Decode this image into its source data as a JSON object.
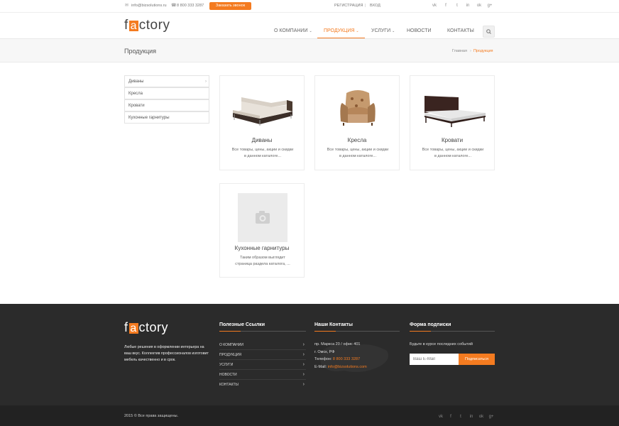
{
  "topbar": {
    "email": "info@bizsolutions.ru",
    "phone": "8 800 333 3287",
    "call_button": "Заказать звонок",
    "register": "РЕГИСТРАЦИЯ",
    "separator": "|",
    "login": "ВХОД",
    "social": [
      "vk",
      "f",
      "t",
      "in",
      "ok",
      "g+"
    ]
  },
  "header": {
    "logo_pre": "f",
    "logo_a": "a",
    "logo_post": "ctory",
    "nav": [
      "О КОМПАНИИ",
      "ПРОДУКЦИЯ",
      "УСЛУГИ",
      "НОВОСТИ",
      "КОНТАКТЫ"
    ],
    "nav_active": "ПРОДУКЦИЯ",
    "search_icon": "search-icon"
  },
  "pagebar": {
    "title": "Продукция",
    "breadcrumb": [
      "Главная",
      "Продукция"
    ]
  },
  "sidebar": {
    "items": [
      "Диваны",
      "Кресла",
      "Кровати",
      "Кухонные гарнитуры"
    ]
  },
  "products": [
    {
      "name": "Диваны",
      "desc": "Все товары, цены, акции и скидки в данном каталоге..."
    },
    {
      "name": "Кресла",
      "desc": "Все товары, цены, акции и скидки в данном каталоге..."
    },
    {
      "name": "Кровати",
      "desc": "Все товары, цены, акции и скидки в данном каталоге..."
    },
    {
      "name": "Кухонные гарнитуры",
      "desc": "Таким образом выглядит страница раздела каталога, ..."
    }
  ],
  "footer": {
    "about": "Любые решения в оформлении интерьера на ваш вкус. Коллектив профессионалов изготовит мебель качественно и в срок.",
    "links_title": "Полезные Ссылки",
    "links": [
      "О КОМПАНИИ",
      "ПРОДУКЦИЯ",
      "УСЛУГИ",
      "НОВОСТИ",
      "КОНТАКТЫ"
    ],
    "contacts_title": "Наши Контакты",
    "address1": "пр. Маркса 20 / офис 401",
    "address2": "г. Омск, РФ",
    "phone_label": "Телефон:",
    "phone": "8 800 333 3287",
    "email_label": "E-Mail:",
    "email": "info@bizsolutions.com",
    "subscribe_title": "Форма подписки",
    "subscribe_text": "Будьте в курсе последних событий",
    "email_placeholder": "Ваш E-Mail",
    "subscribe_button": "Подписаться",
    "copyright": "2015 © Все права защищены."
  },
  "colors": {
    "accent": "#f47b20",
    "footer_bg": "#2b2b2b"
  }
}
